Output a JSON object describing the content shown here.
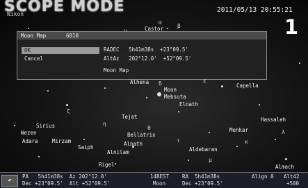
{
  "header": {
    "mode_title": "SCOPE MODE",
    "subtitle": "Nikon",
    "datetime": "2011/05/13 20:55:21",
    "page_number": "1"
  },
  "dialog": {
    "title_left": "Moon Map",
    "title_right": "6010",
    "ok_label": "OK",
    "cancel_label": "Cancel",
    "ra_dec": "RADEC   5h41m38s  +23°09.5'",
    "alt_az": "AltAz   202°12.0'  +52°09.5'",
    "target": "Moon Map"
  },
  "sky": {
    "labels": {
      "castor": "Castor",
      "alhena": "Alhena",
      "moon": "Moon",
      "mebsuta": "Mebsuta",
      "elnath": "Elnath",
      "capella": "Capella",
      "hassaleh": "Hassaleh",
      "tejat": "Tejat",
      "sirius": "Sirius",
      "wezen": "Wezen",
      "adara": "Adara",
      "mirzam": "Mirzam",
      "bellatrix": "Bellatrix",
      "saiph": "Saiph",
      "rigel": "Rigel",
      "aldebaran": "Aldebaran",
      "alnath": "Alnath",
      "alnilam": "Alnilam",
      "almach": "Almach",
      "menkar": "Menkar"
    },
    "symbols": [
      "α",
      "β",
      "γ",
      "δ",
      "ε",
      "ζ",
      "η",
      "θ",
      "ι",
      "κ",
      "λ",
      "μ"
    ]
  },
  "statusbar": {
    "back_icon": "↶",
    "pa": "PA   5h41m38s  Az 202°12.0'",
    "pa_line2": "Dec +23°09.5'  Alt +52°09.5'",
    "mode": "14BEST",
    "mode_line2": "Moon",
    "ra": "RA  5h41m38s",
    "ra_line2": "Dec +23°09.5'",
    "align": "Align 0",
    "align_line2": "",
    "alt_right": "Alt42",
    "alt_right_line2": "+500"
  }
}
